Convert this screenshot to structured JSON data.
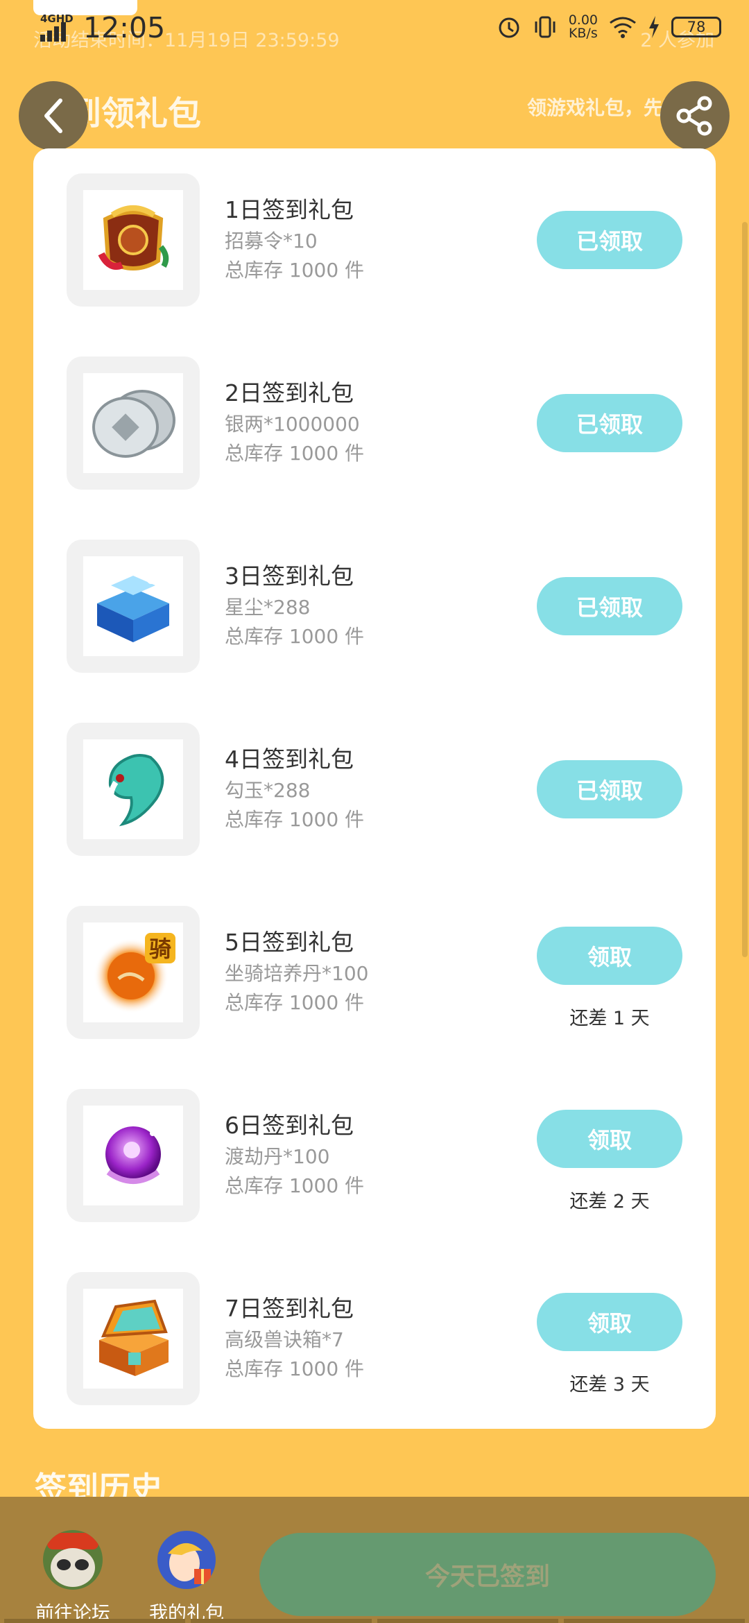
{
  "status_bar": {
    "network": "4GHD",
    "time": "12:05",
    "ghost_left": "活动结束时间：11月19日 23:59:59",
    "ghost_right": "2 人参加",
    "speed_value": "0.00",
    "speed_unit": "KB/s",
    "battery": "78"
  },
  "header": {
    "title": "签到领礼包",
    "hint": "领游戏礼包，先到先得",
    "back_icon": "chevron-left-icon",
    "share_icon": "share-icon"
  },
  "gifts": [
    {
      "name": "1日签到礼包",
      "item": "招募令*10",
      "stock": "总库存 1000 件",
      "button": "已领取",
      "remain": "",
      "icon": "recruit-token-icon"
    },
    {
      "name": "2日签到礼包",
      "item": "银两*1000000",
      "stock": "总库存 1000 件",
      "button": "已领取",
      "remain": "",
      "icon": "silver-coins-icon"
    },
    {
      "name": "3日签到礼包",
      "item": "星尘*288",
      "stock": "总库存 1000 件",
      "button": "已领取",
      "remain": "",
      "icon": "stardust-chest-icon"
    },
    {
      "name": "4日签到礼包",
      "item": "勾玉*288",
      "stock": "总库存 1000 件",
      "button": "已领取",
      "remain": "",
      "icon": "magatama-icon"
    },
    {
      "name": "5日签到礼包",
      "item": "坐骑培养丹*100",
      "stock": "总库存 1000 件",
      "button": "领取",
      "remain": "还差 1 天",
      "icon": "mount-pill-icon",
      "icon_text": "骑"
    },
    {
      "name": "6日签到礼包",
      "item": "渡劫丹*100",
      "stock": "总库存 1000 件",
      "button": "领取",
      "remain": "还差 2 天",
      "icon": "tribulation-pill-icon"
    },
    {
      "name": "7日签到礼包",
      "item": "高级兽诀箱*7",
      "stock": "总库存 1000 件",
      "button": "领取",
      "remain": "还差 3 天",
      "icon": "beast-chest-icon"
    }
  ],
  "history": {
    "title": "签到历史"
  },
  "bottom_bar": {
    "forum_label": "前往论坛",
    "gifts_label": "我的礼包",
    "checkin_label": "今天已签到"
  },
  "colors": {
    "background": "#fec654",
    "claim_button": "#87dfe6",
    "checkin_button": "#659a70"
  }
}
